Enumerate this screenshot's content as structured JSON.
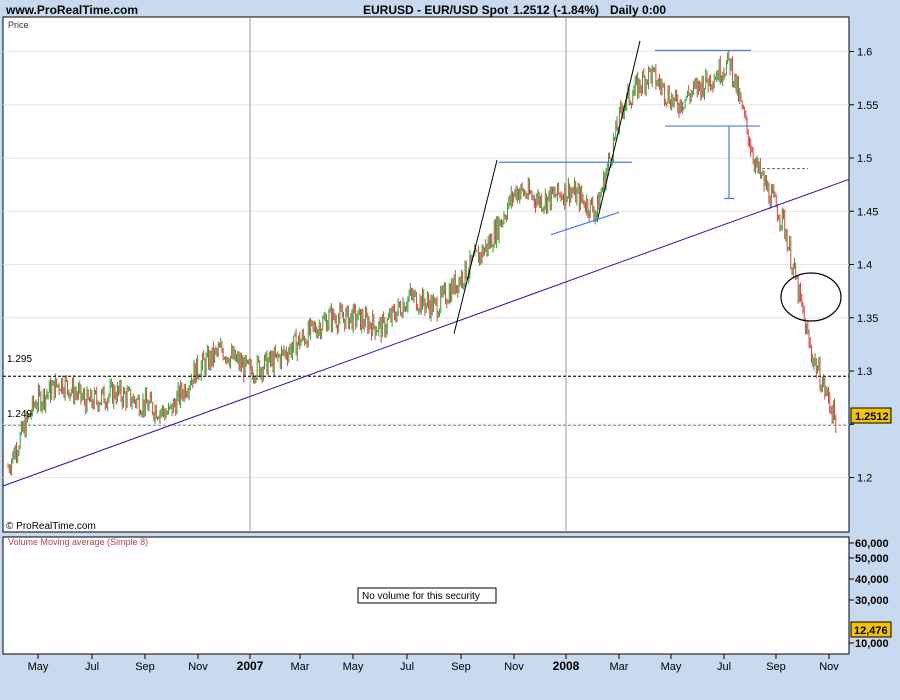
{
  "header": {
    "site": "www.ProRealTime.com",
    "symbol": "EURUSD - EUR/USD Spot",
    "last": "1.2512 (-1.84%)",
    "period": "Daily  0:00"
  },
  "price_panel": {
    "label": "Price",
    "copyright": "© ProRealTime.com",
    "last_price_badge": "1.2512",
    "hline_labels": [
      "1.295",
      "1.249"
    ]
  },
  "volume_panel": {
    "label": "Volume Moving average (Simple 8)",
    "message": "No volume for this security",
    "last_badge": "12,476"
  },
  "colors": {
    "background": "#c7daf0",
    "up_bar": "#2e9e2e",
    "down_bar": "#d94040",
    "trendline": "#1a1aa8",
    "channel": "#4a7bd6",
    "badge": "#f5c400"
  },
  "chart_data": [
    {
      "type": "line",
      "title": "EURUSD - EUR/USD Spot",
      "ylabel": "Price",
      "ylim": [
        1.15,
        1.63
      ],
      "y_ticks": [
        1.2,
        1.25,
        1.3,
        1.35,
        1.4,
        1.45,
        1.5,
        1.55,
        1.6
      ],
      "y_tick_labels": [
        "1.2",
        "",
        "1.3",
        "1.35",
        "1.4",
        "1.45",
        "1.5",
        "1.55",
        "1.6"
      ],
      "x_tick_labels": [
        "May",
        "Jul",
        "Sep",
        "Nov",
        "2007",
        "Mar",
        "May",
        "Jul",
        "Sep",
        "Nov",
        "2008",
        "Mar",
        "May",
        "Jul",
        "Sep",
        "Nov"
      ],
      "year_markers": [
        "2007",
        "2008"
      ],
      "grid": true,
      "series": [
        {
          "x": [
            "Apr 2006",
            "May 2006",
            "Jun 2006",
            "Jul 2006",
            "Aug 2006",
            "Sep 2006",
            "Oct 2006",
            "Nov 2006",
            "Dec 2006",
            "Jan 2007",
            "Feb 2007",
            "Mar 2007",
            "Apr 2007",
            "May 2007",
            "Jun 2007",
            "Jul 2007",
            "Aug 2007",
            "Sep 2007",
            "Oct 2007",
            "Nov 2007",
            "Dec 2007",
            "Jan 2008",
            "Feb 2008",
            "Mar 2008",
            "Apr 2008",
            "May 2008",
            "Jun 2008",
            "Jul 2008",
            "Aug 2008",
            "Sep 2008",
            "Oct 2008",
            "Nov 2008"
          ],
          "values": [
            1.21,
            1.27,
            1.29,
            1.27,
            1.28,
            1.27,
            1.26,
            1.3,
            1.32,
            1.3,
            1.31,
            1.33,
            1.35,
            1.35,
            1.34,
            1.37,
            1.36,
            1.39,
            1.42,
            1.47,
            1.46,
            1.47,
            1.45,
            1.55,
            1.58,
            1.55,
            1.57,
            1.59,
            1.49,
            1.44,
            1.32,
            1.2512
          ]
        }
      ],
      "horizontal_levels": [
        1.295,
        1.249
      ],
      "last_value": 1.2512,
      "last_change_pct": -1.84
    },
    {
      "type": "bar",
      "title": "Volume Moving average (Simple 8)",
      "y_tick_labels": [
        "60,000",
        "50,000",
        "40,000",
        "30,000",
        "10,000"
      ],
      "last_value": 12476,
      "values": []
    }
  ]
}
